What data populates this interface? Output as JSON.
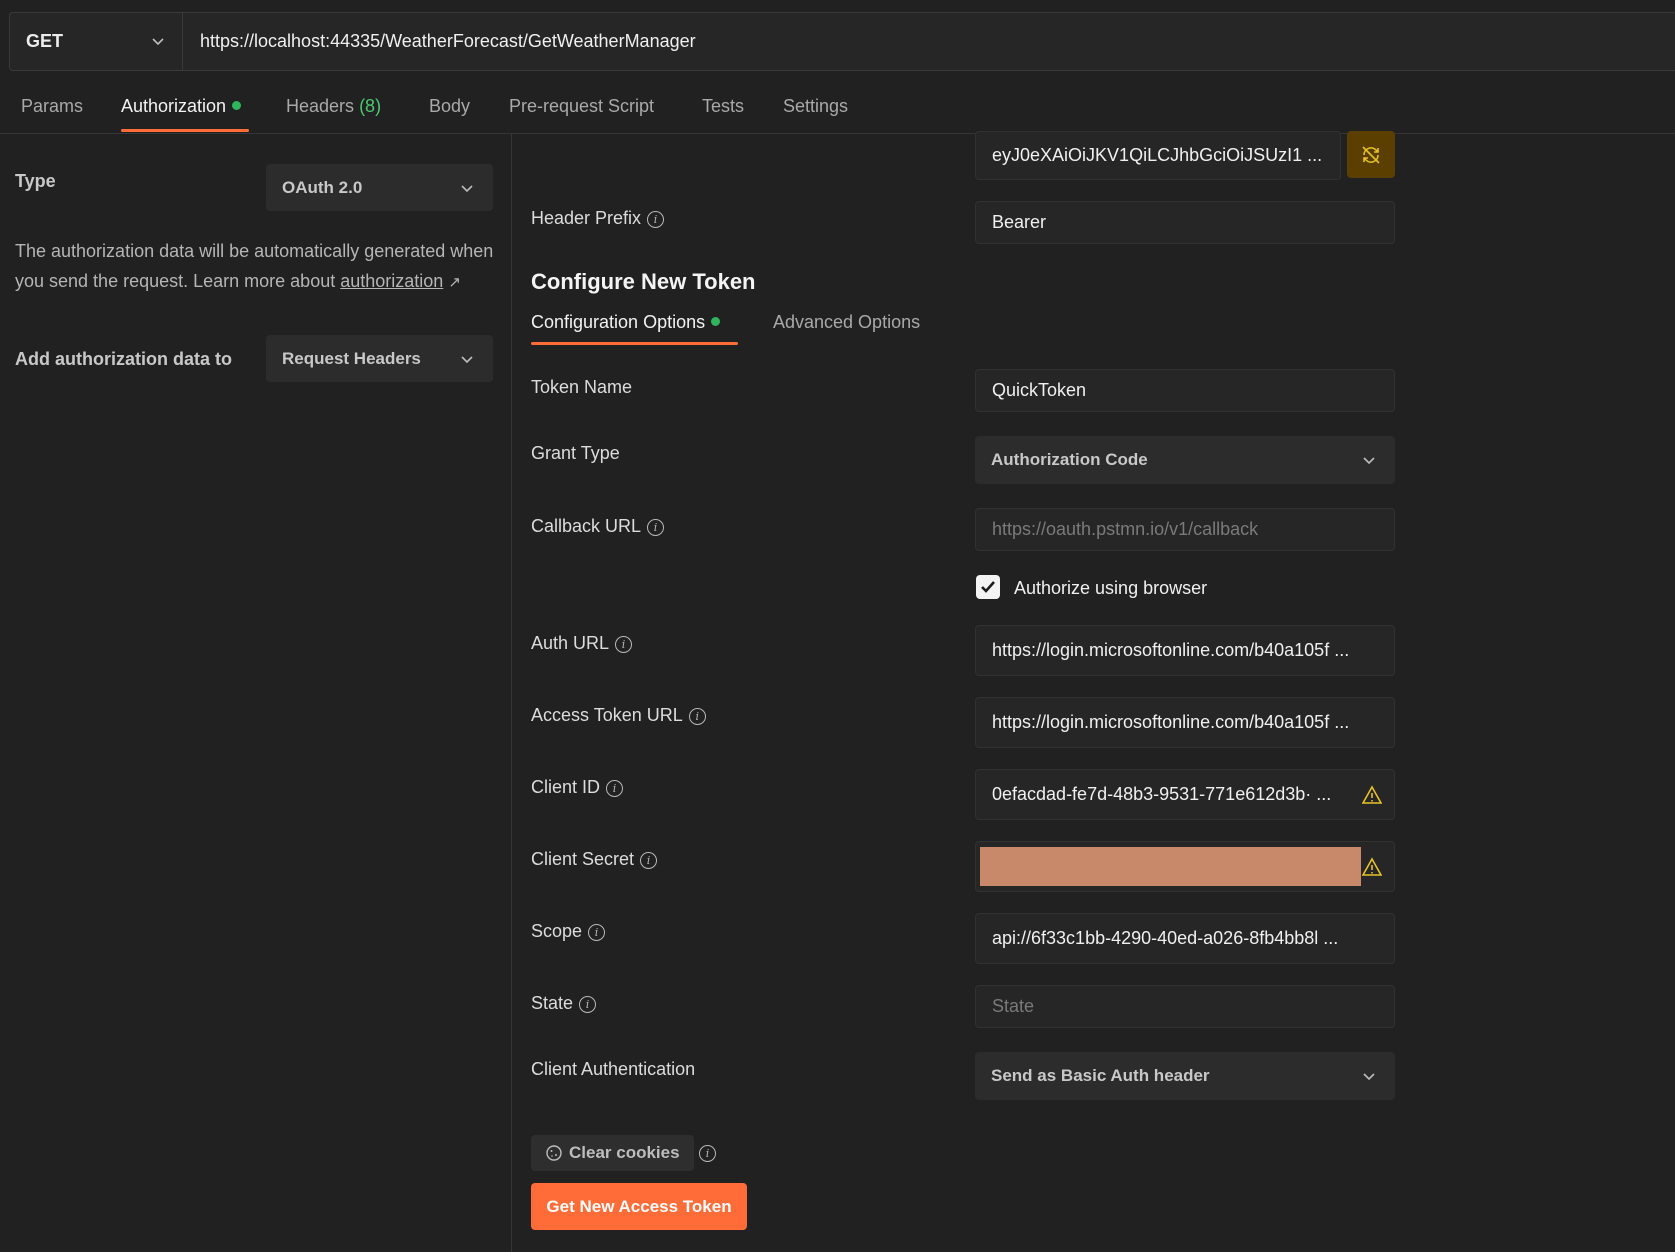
{
  "request": {
    "method": "GET",
    "url": "https://localhost:44335/WeatherForecast/GetWeatherManager"
  },
  "tabs": [
    {
      "label": "Params"
    },
    {
      "label": "Authorization"
    },
    {
      "label": "Headers",
      "count": "(8)"
    },
    {
      "label": "Body"
    },
    {
      "label": "Pre-request Script"
    },
    {
      "label": "Tests"
    },
    {
      "label": "Settings"
    }
  ],
  "left": {
    "type_label": "Type",
    "type_value": "OAuth 2.0",
    "description": "The authorization data will be automatically generated when you send the request. Learn more about",
    "link_text": "authorization",
    "link_arrow": "↗",
    "add_to_label": "Add authorization data to",
    "add_to_value": "Request Headers"
  },
  "right": {
    "token_value": "eyJ0eXAiOiJKV1QiLCJhbGciOiJSUzI1 ...",
    "header_prefix_label": "Header Prefix",
    "header_prefix_value": "Bearer",
    "configure_title": "Configure New Token",
    "subtabs": [
      "Configuration Options",
      "Advanced Options"
    ],
    "token_name_label": "Token Name",
    "token_name_value": "QuickToken",
    "grant_type_label": "Grant Type",
    "grant_type_value": "Authorization Code",
    "callback_url_label": "Callback URL",
    "callback_url_value": "https://oauth.pstmn.io/v1/callback",
    "authorize_browser_label": "Authorize using browser",
    "auth_url_label": "Auth URL",
    "auth_url_value": "https://login.microsoftonline.com/b40a105f ...",
    "access_token_url_label": "Access Token URL",
    "access_token_url_value": "https://login.microsoftonline.com/b40a105f ...",
    "client_id_label": "Client ID",
    "client_id_value": "0efacdad-fe7d-48b3-9531-771e612d3b· ...",
    "client_secret_label": "Client Secret",
    "scope_label": "Scope",
    "scope_value": "api://6f33c1bb-4290-40ed-a026-8fb4bb8l ...",
    "state_label": "State",
    "state_placeholder": "State",
    "client_auth_label": "Client Authentication",
    "client_auth_value": "Send as Basic Auth header",
    "clear_cookies_label": "Clear cookies",
    "get_token_label": "Get New Access Token"
  },
  "colors": {
    "accent": "#ff6c37",
    "status_dot": "#2fb55b",
    "warning": "#e6c229",
    "background": "#212121"
  }
}
